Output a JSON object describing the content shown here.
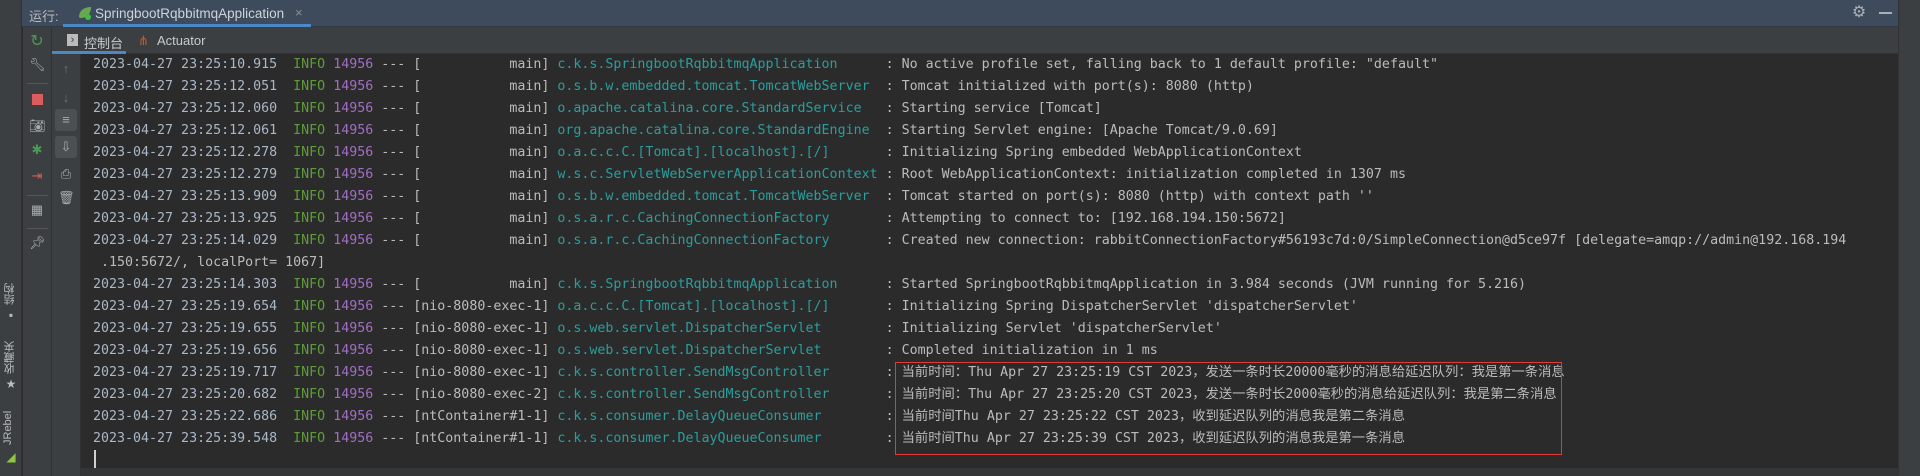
{
  "run_label": "运行:",
  "run_tab": {
    "title": "SpringbootRqbbitmqApplication",
    "close": "×"
  },
  "subtabs": [
    {
      "label": "控制台"
    },
    {
      "label": "Actuator"
    }
  ],
  "left_stripe": [
    {
      "label": "结构"
    },
    {
      "label": "收藏夹"
    },
    {
      "label": "JRebel"
    }
  ],
  "colors": {
    "timestamp": "#a9b7c6",
    "info": "#5e9c3a",
    "pid": "#a06fc3",
    "logger": "#2a9e9e",
    "text": "#bbbbbb",
    "highlight_box": "#e03a3a",
    "tab_accent": "#4a88c7"
  },
  "log_sep": "---",
  "log": [
    {
      "ts": "2023-04-27 23:25:10.915",
      "level": "INFO",
      "pid": "14956",
      "thread": "main",
      "logger": "c.k.s.SpringbootRqbbitmqApplication",
      "msg": "No active profile set, falling back to 1 default profile: \"default\""
    },
    {
      "ts": "2023-04-27 23:25:12.051",
      "level": "INFO",
      "pid": "14956",
      "thread": "main",
      "logger": "o.s.b.w.embedded.tomcat.TomcatWebServer",
      "msg": "Tomcat initialized with port(s): 8080 (http)"
    },
    {
      "ts": "2023-04-27 23:25:12.060",
      "level": "INFO",
      "pid": "14956",
      "thread": "main",
      "logger": "o.apache.catalina.core.StandardService",
      "msg": "Starting service [Tomcat]"
    },
    {
      "ts": "2023-04-27 23:25:12.061",
      "level": "INFO",
      "pid": "14956",
      "thread": "main",
      "logger": "org.apache.catalina.core.StandardEngine",
      "msg": "Starting Servlet engine: [Apache Tomcat/9.0.69]"
    },
    {
      "ts": "2023-04-27 23:25:12.278",
      "level": "INFO",
      "pid": "14956",
      "thread": "main",
      "logger": "o.a.c.c.C.[Tomcat].[localhost].[/]",
      "msg": "Initializing Spring embedded WebApplicationContext"
    },
    {
      "ts": "2023-04-27 23:25:12.279",
      "level": "INFO",
      "pid": "14956",
      "thread": "main",
      "logger": "w.s.c.ServletWebServerApplicationContext",
      "msg": "Root WebApplicationContext: initialization completed in 1307 ms"
    },
    {
      "ts": "2023-04-27 23:25:13.909",
      "level": "INFO",
      "pid": "14956",
      "thread": "main",
      "logger": "o.s.b.w.embedded.tomcat.TomcatWebServer",
      "msg": "Tomcat started on port(s): 8080 (http) with context path ''"
    },
    {
      "ts": "2023-04-27 23:25:13.925",
      "level": "INFO",
      "pid": "14956",
      "thread": "main",
      "logger": "o.s.a.r.c.CachingConnectionFactory",
      "msg": "Attempting to connect to: [192.168.194.150:5672]"
    },
    {
      "ts": "2023-04-27 23:25:14.029",
      "level": "INFO",
      "pid": "14956",
      "thread": "main",
      "logger": "o.s.a.r.c.CachingConnectionFactory",
      "msg": "Created new connection: rabbitConnectionFactory#56193c7d:0/SimpleConnection@d5ce97f [delegate=amqp://admin@192.168.194"
    },
    {
      "cont": " .150:5672/, localPort= 1067]"
    },
    {
      "ts": "2023-04-27 23:25:14.303",
      "level": "INFO",
      "pid": "14956",
      "thread": "main",
      "logger": "c.k.s.SpringbootRqbbitmqApplication",
      "msg": "Started SpringbootRqbbitmqApplication in 3.984 seconds (JVM running for 5.216)"
    },
    {
      "ts": "2023-04-27 23:25:19.654",
      "level": "INFO",
      "pid": "14956",
      "thread": "nio-8080-exec-1",
      "logger": "o.a.c.c.C.[Tomcat].[localhost].[/]",
      "msg": "Initializing Spring DispatcherServlet 'dispatcherServlet'"
    },
    {
      "ts": "2023-04-27 23:25:19.655",
      "level": "INFO",
      "pid": "14956",
      "thread": "nio-8080-exec-1",
      "logger": "o.s.web.servlet.DispatcherServlet",
      "msg": "Initializing Servlet 'dispatcherServlet'"
    },
    {
      "ts": "2023-04-27 23:25:19.656",
      "level": "INFO",
      "pid": "14956",
      "thread": "nio-8080-exec-1",
      "logger": "o.s.web.servlet.DispatcherServlet",
      "msg": "Completed initialization in 1 ms"
    },
    {
      "ts": "2023-04-27 23:25:19.717",
      "level": "INFO",
      "pid": "14956",
      "thread": "nio-8080-exec-1",
      "logger": "c.k.s.controller.SendMsgController",
      "msg": "当前时间：Thu Apr 27 23:25:19 CST 2023，发送一条时长20000毫秒的消息给延迟队列：我是第一条消息"
    },
    {
      "ts": "2023-04-27 23:25:20.682",
      "level": "INFO",
      "pid": "14956",
      "thread": "nio-8080-exec-2",
      "logger": "c.k.s.controller.SendMsgController",
      "msg": "当前时间：Thu Apr 27 23:25:20 CST 2023，发送一条时长2000毫秒的消息给延迟队列：我是第二条消息"
    },
    {
      "ts": "2023-04-27 23:25:22.686",
      "level": "INFO",
      "pid": "14956",
      "thread": "ntContainer#1-1",
      "logger": "c.k.s.consumer.DelayQueueConsumer",
      "msg": "当前时间Thu Apr 27 23:25:22 CST 2023，收到延迟队列的消息我是第二条消息"
    },
    {
      "ts": "2023-04-27 23:25:39.548",
      "level": "INFO",
      "pid": "14956",
      "thread": "ntContainer#1-1",
      "logger": "c.k.s.consumer.DelayQueueConsumer",
      "msg": "当前时间Thu Apr 27 23:25:39 CST 2023，收到延迟队列的消息我是第一条消息"
    }
  ]
}
